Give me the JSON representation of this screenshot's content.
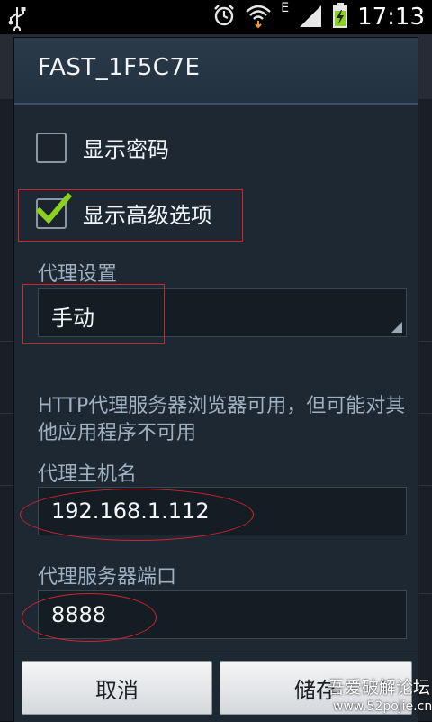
{
  "status_bar": {
    "time": "17:13",
    "network_type": "E",
    "icons": [
      "usb-icon",
      "alarm-icon",
      "wifi-icon",
      "signal-icon",
      "battery-charging-icon"
    ]
  },
  "dialog": {
    "title": "FAST_1F5C7E",
    "show_password": {
      "label": "显示密码",
      "checked": false
    },
    "show_advanced": {
      "label": "显示高级选项",
      "checked": true
    },
    "proxy_settings": {
      "label": "代理设置",
      "value": "手动"
    },
    "proxy_note": "HTTP代理服务器浏览器可用，但可能对其他应用程序不可用",
    "proxy_hostname": {
      "label": "代理主机名",
      "value": "192.168.1.112"
    },
    "proxy_port": {
      "label": "代理服务器端口",
      "value": "8888"
    },
    "buttons": {
      "cancel": "取消",
      "save": "储存"
    }
  },
  "watermark": {
    "text": "吾爱破解论坛",
    "url": "www.52pojie.cn"
  },
  "colors": {
    "highlight": "#d3232a",
    "check": "#8cd11f",
    "dialog_bg": "#1d2833"
  }
}
